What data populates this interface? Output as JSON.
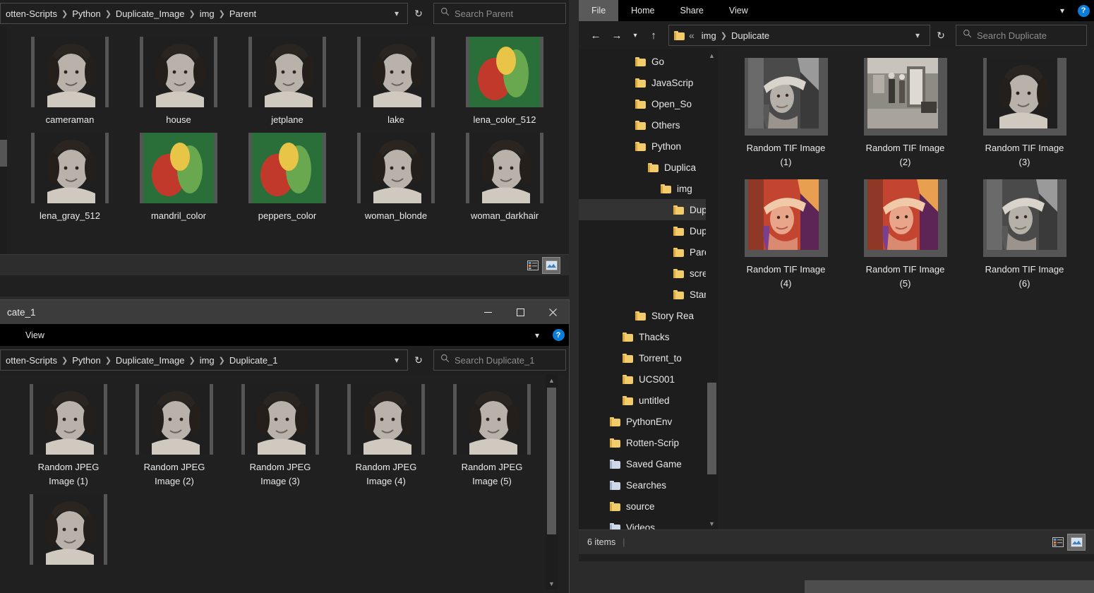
{
  "colors": {
    "accent": "#0a7ddb",
    "window_bg": "#202020",
    "titlebar": "#3c3c3c",
    "selection": "#333333",
    "folder_yellow": "#f2cb6a"
  },
  "window_back": {
    "name": "Parent folder window",
    "breadcrumb": [
      "otten-Scripts",
      "Python",
      "Duplicate_Image",
      "img",
      "Parent"
    ],
    "breadcrumb_dropdown": "chevron-down",
    "refresh": "refresh",
    "search_placeholder": "Search Parent",
    "files": [
      {
        "name": "cameraman",
        "kind": "gray-photo"
      },
      {
        "name": "house",
        "kind": "gray-photo"
      },
      {
        "name": "jetplane",
        "kind": "gray-photo"
      },
      {
        "name": "lake",
        "kind": "gray-photo"
      },
      {
        "name": "lena_color_512",
        "kind": "color-photo"
      },
      {
        "name": "lena_gray_512",
        "kind": "gray-photo"
      },
      {
        "name": "mandril_color",
        "kind": "color-photo"
      },
      {
        "name": "peppers_color",
        "kind": "color-photo"
      },
      {
        "name": "woman_blonde",
        "kind": "gray-photo"
      },
      {
        "name": "woman_darkhair",
        "kind": "gray-photo"
      }
    ],
    "status": {
      "details_view": "details-view",
      "large_icons_view": "large-icons-view"
    }
  },
  "window_mid": {
    "name": "Duplicate_1 folder window",
    "title": "cate_1",
    "minimize": "─",
    "maximize": "□",
    "close": "✕",
    "ribbon_tabs": [
      "View"
    ],
    "ribbon_chevron": "chevron-down",
    "help": "?",
    "breadcrumb": [
      "otten-Scripts",
      "Python",
      "Duplicate_Image",
      "img",
      "Duplicate_1"
    ],
    "search_placeholder": "Search Duplicate_1",
    "files": [
      {
        "name": "Random JPEG Image (1)",
        "kind": "gray-photo"
      },
      {
        "name": "Random JPEG Image (2)",
        "kind": "gray-photo"
      },
      {
        "name": "Random JPEG Image (3)",
        "kind": "gray-photo"
      },
      {
        "name": "Random JPEG Image (4)",
        "kind": "gray-photo"
      },
      {
        "name": "Random JPEG Image (5)",
        "kind": "gray-photo"
      },
      {
        "name": "",
        "kind": "gray-photo"
      }
    ]
  },
  "window_right": {
    "name": "Duplicate folder window",
    "ribbon_tabs": [
      "File",
      "Home",
      "Share",
      "View"
    ],
    "ribbon_chevron": "chevron-down",
    "help": "?",
    "nav": {
      "back": "←",
      "forward": "→",
      "recent": "⌄",
      "up": "↑"
    },
    "breadcrumb_prefix": "«",
    "breadcrumb": [
      "img",
      "Duplicate"
    ],
    "search_placeholder": "Search Duplicate",
    "tree": [
      {
        "label": "Go",
        "indent": 1,
        "icon": "folder",
        "selected": false
      },
      {
        "label": "JavaScrip",
        "indent": 1,
        "icon": "folder",
        "selected": false
      },
      {
        "label": "Open_So",
        "indent": 1,
        "icon": "folder",
        "selected": false
      },
      {
        "label": "Others",
        "indent": 1,
        "icon": "folder",
        "selected": false
      },
      {
        "label": "Python",
        "indent": 1,
        "icon": "folder",
        "selected": false
      },
      {
        "label": "Duplica",
        "indent": 2,
        "icon": "folder",
        "selected": false
      },
      {
        "label": "img",
        "indent": 3,
        "icon": "folder",
        "selected": false
      },
      {
        "label": "Dup",
        "indent": 4,
        "icon": "folder",
        "selected": true
      },
      {
        "label": "Dup",
        "indent": 4,
        "icon": "folder",
        "selected": false
      },
      {
        "label": "Pare",
        "indent": 4,
        "icon": "folder",
        "selected": false
      },
      {
        "label": "scree",
        "indent": 4,
        "icon": "folder",
        "selected": false
      },
      {
        "label": "Stan",
        "indent": 4,
        "icon": "folder",
        "selected": false
      },
      {
        "label": "Story Rea",
        "indent": 1,
        "icon": "folder",
        "selected": false
      },
      {
        "label": "Thacks",
        "indent": 0,
        "icon": "folder",
        "selected": false
      },
      {
        "label": "Torrent_to",
        "indent": 0,
        "icon": "folder",
        "selected": false
      },
      {
        "label": "UCS001",
        "indent": 0,
        "icon": "folder",
        "selected": false
      },
      {
        "label": "untitled",
        "indent": 0,
        "icon": "folder",
        "selected": false
      },
      {
        "label": "PythonEnv",
        "indent": -1,
        "icon": "folder",
        "selected": false
      },
      {
        "label": "Rotten-Scrip",
        "indent": -1,
        "icon": "folder",
        "selected": false
      },
      {
        "label": "Saved Game",
        "indent": -1,
        "icon": "folder-saved-games",
        "selected": false
      },
      {
        "label": "Searches",
        "indent": -1,
        "icon": "folder-searches",
        "selected": false
      },
      {
        "label": "source",
        "indent": -1,
        "icon": "folder",
        "selected": false
      },
      {
        "label": "Videos",
        "indent": -1,
        "icon": "folder-videos",
        "selected": false
      }
    ],
    "files": [
      {
        "name": "Random TIF Image (1)",
        "kind": "lena-gray"
      },
      {
        "name": "Random TIF Image (2)",
        "kind": "room-gray"
      },
      {
        "name": "Random TIF Image (3)",
        "kind": "woman-gray"
      },
      {
        "name": "Random TIF Image (4)",
        "kind": "lena-color"
      },
      {
        "name": "Random TIF Image (5)",
        "kind": "lena-color"
      },
      {
        "name": "Random TIF Image (6)",
        "kind": "lena-gray"
      }
    ],
    "status": {
      "item_count": "6 items",
      "details_view": "details-view",
      "large_icons_view": "large-icons-view"
    }
  }
}
